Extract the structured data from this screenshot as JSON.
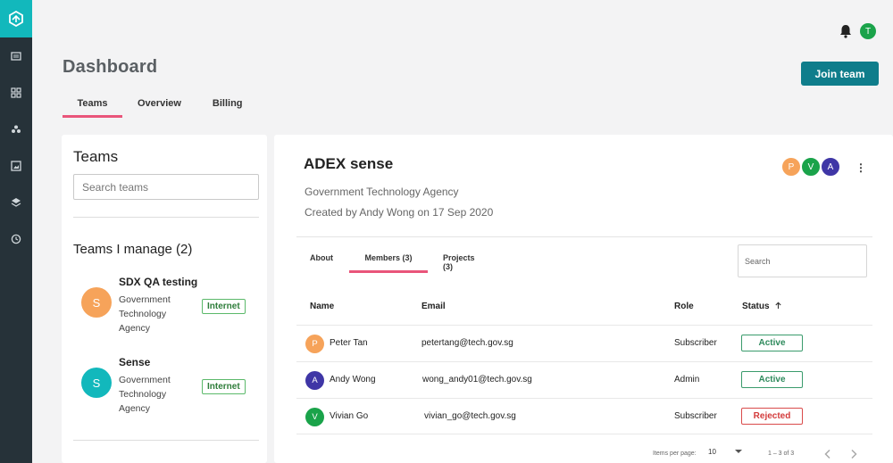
{
  "sidebar": {
    "logo_icon": "hexagon-logo-icon",
    "items": [
      {
        "icon": "catalog-icon"
      },
      {
        "icon": "dashboard-grid-icon"
      },
      {
        "icon": "teams-icon"
      },
      {
        "icon": "image-gallery-icon"
      },
      {
        "icon": "layers-icon"
      },
      {
        "icon": "history-clock-icon"
      }
    ]
  },
  "header": {
    "notification_icon": "bell-icon",
    "user_initial": "T"
  },
  "page": {
    "title": "Dashboard",
    "join_button": "Join team",
    "tabs": [
      {
        "label": "Teams",
        "active": true
      },
      {
        "label": "Overview",
        "active": false
      },
      {
        "label": "Billing",
        "active": false
      }
    ]
  },
  "teams_panel": {
    "title": "Teams",
    "search_placeholder": "Search teams",
    "manage_heading": "Teams I manage (2)",
    "teams": [
      {
        "initial": "S",
        "name": "SDX QA testing",
        "org_lines": [
          "Government",
          "Technology",
          "Agency"
        ],
        "badge": "Internet",
        "color": "#f6a35a"
      },
      {
        "initial": "S",
        "name": "Sense",
        "org_lines": [
          "Government",
          "Technology",
          "Agency"
        ],
        "badge": "Internet",
        "color": "#12b8bc"
      }
    ]
  },
  "team_detail": {
    "name": "ADEX sense",
    "organization": "Government Technology Agency",
    "created": "Created by Andy Wong on 17 Sep 2020",
    "member_avatars": [
      {
        "initial": "P",
        "color": "#f6a35a"
      },
      {
        "initial": "V",
        "color": "#1aa34a"
      },
      {
        "initial": "A",
        "color": "#3f36a6"
      }
    ],
    "more_icon": "kebab-menu-icon",
    "tabs": [
      {
        "label": "About",
        "active": false
      },
      {
        "label": "Members (3)",
        "active": true
      },
      {
        "label": "Projects (3)",
        "active": false
      }
    ],
    "search_placeholder": "Search",
    "columns": {
      "name": "Name",
      "email": "Email",
      "role": "Role",
      "status": "Status",
      "sort_icon": "arrow-up-icon"
    },
    "members": [
      {
        "initial": "P",
        "color": "#f6a35a",
        "name": "Peter Tan",
        "email": "petertang@tech.gov.sg",
        "role": "Subscriber",
        "status": "Active"
      },
      {
        "initial": "A",
        "color": "#3f36a6",
        "name": "Andy Wong",
        "email": "wong_andy01@tech.gov.sg",
        "role": "Admin",
        "status": "Active"
      },
      {
        "initial": "V",
        "color": "#1aa34a",
        "name": "Vivian Go",
        "email": "vivian_go@tech.gov.sg",
        "role": "Subscriber",
        "status": "Rejected"
      }
    ],
    "pagination": {
      "items_per_page_label": "Items per page:",
      "items_per_page": "10",
      "range": "1 – 3 of 3"
    }
  }
}
